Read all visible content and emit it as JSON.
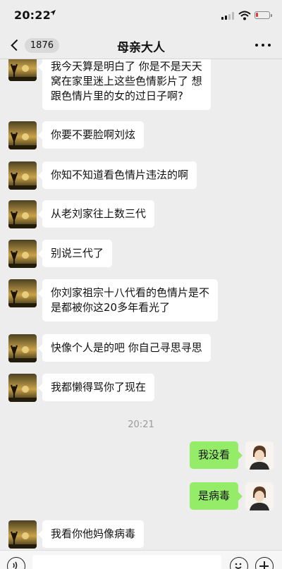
{
  "status_bar": {
    "time": "20:22",
    "location_icon": "location-arrow-icon",
    "signal_icon": "cellular-signal-icon",
    "wifi_icon": "wifi-icon",
    "battery_icon": "battery-low-icon",
    "battery_level": 0.15,
    "battery_color": "#e53935"
  },
  "nav": {
    "back_badge": "1876",
    "title": "母亲大人",
    "back_icon": "chevron-left-icon",
    "more_icon": "more-dots-icon"
  },
  "colors": {
    "background": "#ededed",
    "incoming_bubble": "#ffffff",
    "outgoing_bubble": "#95ec69"
  },
  "messages": [
    {
      "side": "left",
      "lines": [
        "我今天算是明白了 你是不是天天",
        "窝在家里迷上这些色情影片了 想",
        "跟色情片里的女的过日子啊?"
      ]
    },
    {
      "side": "left",
      "lines": [
        "你要不要脸啊刘炫"
      ]
    },
    {
      "side": "left",
      "lines": [
        "你知不知道看色情片违法的啊"
      ]
    },
    {
      "side": "left",
      "lines": [
        "从老刘家往上数三代"
      ]
    },
    {
      "side": "left",
      "lines": [
        "别说三代了"
      ]
    },
    {
      "side": "left",
      "lines": [
        "你刘家祖宗十八代看的色情片是不",
        "是都被你这20多年看光了"
      ]
    },
    {
      "side": "left",
      "lines": [
        "快像个人是的吧 你自己寻思寻思"
      ]
    },
    {
      "side": "left",
      "lines": [
        "我都懒得骂你了现在"
      ]
    },
    {
      "type": "time",
      "text": "20:21"
    },
    {
      "side": "right",
      "lines": [
        "我没看"
      ]
    },
    {
      "side": "right",
      "lines": [
        "是病毒"
      ]
    },
    {
      "side": "left",
      "lines": [
        "我看你他妈像病毒"
      ]
    }
  ],
  "input_bar": {
    "voice_icon": "voice-icon",
    "emoji_icon": "emoji-icon",
    "plus_icon": "plus-icon"
  }
}
